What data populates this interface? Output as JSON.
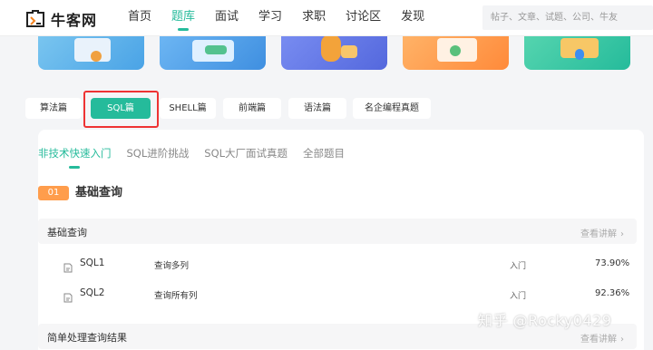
{
  "header": {
    "logo_text": "牛客网",
    "nav": [
      {
        "label": "首页"
      },
      {
        "label": "题库",
        "active": true
      },
      {
        "label": "面试"
      },
      {
        "label": "学习"
      },
      {
        "label": "求职"
      },
      {
        "label": "讨论区"
      },
      {
        "label": "发现"
      }
    ],
    "search_placeholder": "帖子、文章、试题、公司、牛友"
  },
  "categories": [
    {
      "label": "算法篇"
    },
    {
      "label": "SQL篇",
      "active": true
    },
    {
      "label": "SHELL篇"
    },
    {
      "label": "前端篇"
    },
    {
      "label": "语法篇"
    },
    {
      "label": "名企编程真题"
    }
  ],
  "subtabs": [
    {
      "label": "非技术快速入门",
      "active": true
    },
    {
      "label": "SQL进阶挑战"
    },
    {
      "label": "SQL大厂面试真题"
    },
    {
      "label": "全部题目"
    }
  ],
  "section": {
    "num": "01",
    "title": "基础查询"
  },
  "groups": [
    {
      "title": "基础查询",
      "link": "查看讲解",
      "rows": [
        {
          "code": "SQL1",
          "name": "查询多列",
          "level": "入门",
          "rate": "73.90%"
        },
        {
          "code": "SQL2",
          "name": "查询所有列",
          "level": "入门",
          "rate": "92.36%"
        }
      ]
    },
    {
      "title": "简单处理查询结果",
      "link": "查看讲解"
    }
  ],
  "watermark": "知乎 @Rocky0429",
  "colors": {
    "accent": "#25bb9b",
    "section_badge": "#ff9d4c",
    "highlight_box": "#e33333"
  }
}
